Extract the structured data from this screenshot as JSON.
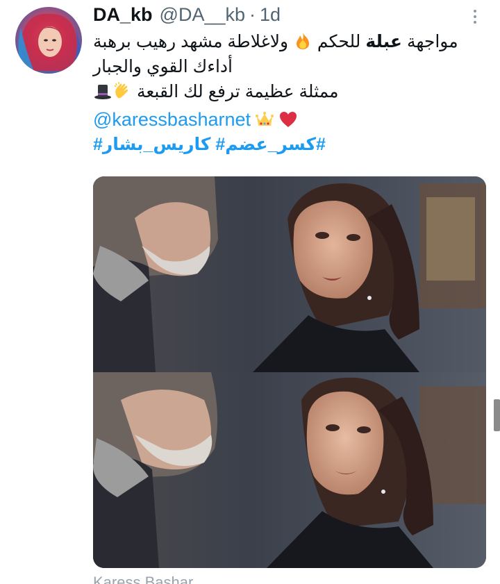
{
  "tweet": {
    "author": {
      "display_name": "DA_kb",
      "handle": "@DA__kb",
      "separator": "·",
      "time": "1d"
    },
    "text": {
      "line1_pre": "مواجهة ",
      "line1_bold": "عبلة",
      "line1_post": " للحكم ",
      "line1_tail": " ولاغلاطة مشهد رهيب برهبة",
      "line2": "أداءك القوي والجبار",
      "line3": "ممثلة عظيمة ترفع لك القبعة "
    },
    "mention": "@karessbasharnet",
    "hashtags": "#كسر_عضم# كاريس_بشار#",
    "icons": [
      "more-icon",
      "fire-emoji-icon",
      "clapping-hands-emoji-icon",
      "top-hat-emoji-icon",
      "crown-emoji-icon",
      "red-heart-emoji-icon"
    ],
    "media": {
      "frames": 2
    },
    "next_tweet_peek": "Karess Bashar"
  },
  "colors": {
    "text": "#0f1419",
    "secondary": "#536471",
    "link": "#1d9bf0",
    "background": "#ffffff"
  }
}
